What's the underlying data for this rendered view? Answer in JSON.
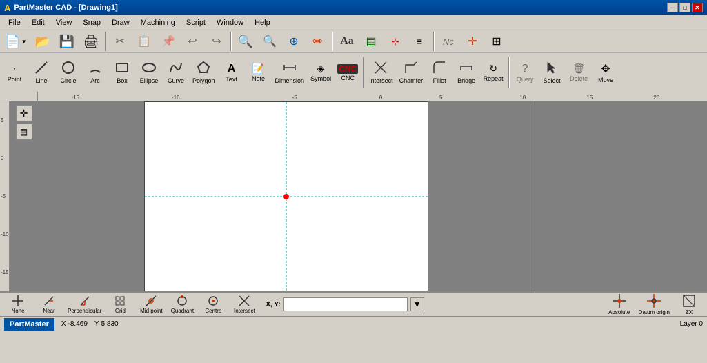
{
  "titlebar": {
    "icon": "A",
    "title": "PartMaster CAD - [Drawing1]",
    "minimize": "─",
    "maximize": "□",
    "close": "✕",
    "app_minimize": "─",
    "app_maximize": "□",
    "app_close": "✕"
  },
  "menubar": {
    "items": [
      "File",
      "Edit",
      "View",
      "Snap",
      "Draw",
      "Machining",
      "Script",
      "Window",
      "Help"
    ]
  },
  "toolbar1": {
    "buttons": [
      {
        "id": "new",
        "icon": "📄",
        "label": "New"
      },
      {
        "id": "open",
        "icon": "📂",
        "label": "Open"
      },
      {
        "id": "save",
        "icon": "💾",
        "label": "Save"
      },
      {
        "id": "print",
        "icon": "🖨",
        "label": "Print"
      },
      {
        "id": "cut",
        "icon": "✂",
        "label": "Cut"
      },
      {
        "id": "copy",
        "icon": "📋",
        "label": "Copy"
      },
      {
        "id": "paste",
        "icon": "📌",
        "label": "Paste"
      },
      {
        "id": "undo",
        "icon": "↩",
        "label": "Undo"
      },
      {
        "id": "redo",
        "icon": "↪",
        "label": "Redo"
      },
      {
        "id": "zoom",
        "icon": "🔍",
        "label": "Zoom"
      },
      {
        "id": "previous",
        "icon": "🔍",
        "label": "Previous"
      },
      {
        "id": "zoomview",
        "icon": "🔍",
        "label": "Zoom View"
      },
      {
        "id": "redraw",
        "icon": "✏",
        "label": "Redraw"
      },
      {
        "id": "textstyle",
        "icon": "Aa",
        "label": "Text Style"
      },
      {
        "id": "layer",
        "icon": "▦",
        "label": "Layer"
      },
      {
        "id": "linetype",
        "icon": "—",
        "label": "Line Type"
      },
      {
        "id": "linewidth",
        "icon": "≡",
        "label": "Line Width"
      },
      {
        "id": "ncgallery",
        "icon": "Nc",
        "label": "NC gallery"
      },
      {
        "id": "gridsetup",
        "icon": "⊞",
        "label": "Grid Setup"
      },
      {
        "id": "grid",
        "icon": "⊞",
        "label": "Grid"
      }
    ]
  },
  "toolbar2": {
    "buttons": [
      {
        "id": "point",
        "label": "Point"
      },
      {
        "id": "line",
        "label": "Line"
      },
      {
        "id": "circle",
        "label": "Circle"
      },
      {
        "id": "arc",
        "label": "Arc"
      },
      {
        "id": "box",
        "label": "Box"
      },
      {
        "id": "ellipse",
        "label": "Ellipse"
      },
      {
        "id": "curve",
        "label": "Curve"
      },
      {
        "id": "polygon",
        "label": "Polygon"
      },
      {
        "id": "text",
        "label": "Text"
      },
      {
        "id": "note",
        "label": "Note"
      },
      {
        "id": "dimension",
        "label": "Dimension"
      },
      {
        "id": "symbol",
        "label": "Symbol"
      },
      {
        "id": "cnc",
        "label": "CNC"
      },
      {
        "id": "intersect",
        "label": "Intersect"
      },
      {
        "id": "chamfer",
        "label": "Chamfer"
      },
      {
        "id": "fillet",
        "label": "Fillet"
      },
      {
        "id": "bridge",
        "label": "Bridge"
      },
      {
        "id": "repeat",
        "label": "Repeat"
      },
      {
        "id": "query",
        "label": "Query"
      },
      {
        "id": "select",
        "label": "Select"
      },
      {
        "id": "delete",
        "label": "Delete"
      },
      {
        "id": "move",
        "label": "Move"
      }
    ]
  },
  "snap_toolbar": {
    "xy_label": "X, Y:",
    "buttons": [
      {
        "id": "none",
        "label": "None"
      },
      {
        "id": "near",
        "label": "Near"
      },
      {
        "id": "perpendicular",
        "label": "Perpendicular"
      },
      {
        "id": "grid",
        "label": "Grid"
      },
      {
        "id": "midpoint",
        "label": "Mid point"
      },
      {
        "id": "quadrant",
        "label": "Quadrant"
      },
      {
        "id": "centre",
        "label": "Centre"
      },
      {
        "id": "intersect",
        "label": "Intersect"
      }
    ],
    "right_buttons": [
      {
        "id": "absolute",
        "label": "Absolute"
      },
      {
        "id": "datum_origin",
        "label": "Datum origin"
      },
      {
        "id": "zx",
        "label": "ZX"
      }
    ]
  },
  "statusbar": {
    "app_label": "PartMaster",
    "x_label": "X",
    "x_value": "-8.469",
    "y_label": "Y",
    "y_value": "5.830",
    "layer": "Layer 0"
  },
  "canvas": {
    "bg": "white"
  }
}
